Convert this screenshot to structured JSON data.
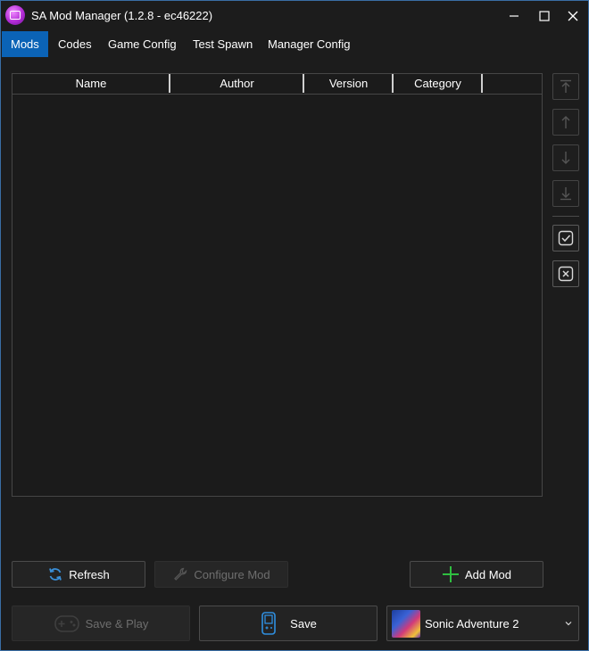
{
  "window": {
    "title": "SA Mod Manager (1.2.8 - ec46222)"
  },
  "tabs": [
    {
      "label": "Mods",
      "active": true
    },
    {
      "label": "Codes",
      "active": false
    },
    {
      "label": "Game Config",
      "active": false
    },
    {
      "label": "Test Spawn",
      "active": false
    },
    {
      "label": "Manager Config",
      "active": false
    }
  ],
  "grid": {
    "columns": [
      "Name",
      "Author",
      "Version",
      "Category"
    ],
    "rows": []
  },
  "side_buttons": [
    {
      "icon": "move-to-top-icon",
      "enabled": false
    },
    {
      "icon": "move-up-icon",
      "enabled": false
    },
    {
      "icon": "move-down-icon",
      "enabled": false
    },
    {
      "icon": "move-to-bottom-icon",
      "enabled": false
    },
    {
      "icon": "check-all-icon",
      "enabled": true
    },
    {
      "icon": "uncheck-all-icon",
      "enabled": true
    }
  ],
  "actions": {
    "refresh_label": "Refresh",
    "configure_label": "Configure Mod",
    "add_label": "Add Mod",
    "save_play_label": "Save & Play",
    "save_label": "Save"
  },
  "game_select": {
    "selected": "Sonic Adventure 2"
  },
  "colors": {
    "accent": "#0b63b6",
    "background": "#1c1c1c",
    "add_icon": "#2fbf40",
    "refresh_icon": "#3a8fd8",
    "save_icon": "#2f8fe0"
  }
}
